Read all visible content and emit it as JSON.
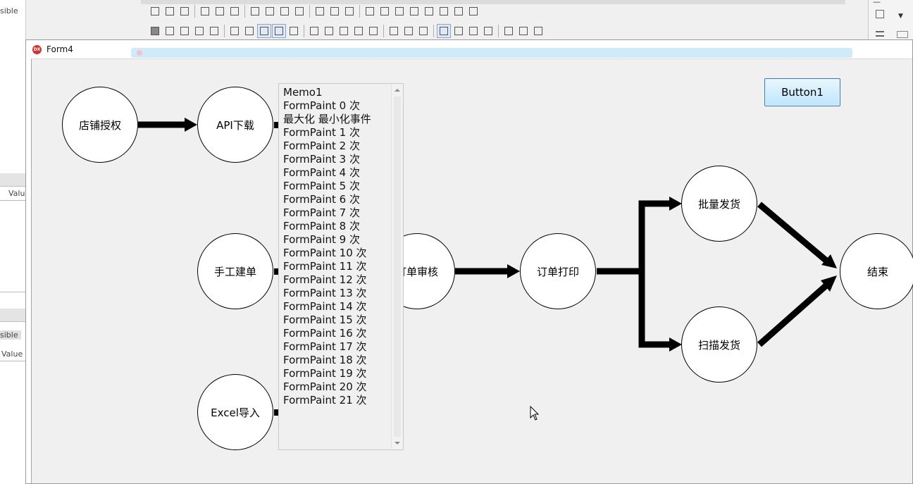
{
  "ide": {
    "left_labels": [
      "sible",
      "Valu",
      "sible",
      "Value"
    ]
  },
  "form": {
    "title": "Form4"
  },
  "nodes": {
    "store_auth": "店铺授权",
    "api_download": "API下载",
    "manual_order": "手工建单",
    "excel_import": "Excel导入",
    "order_review": "订单审核",
    "order_print": "订单打印",
    "batch_ship": "批量发货",
    "scan_ship": "扫描发货",
    "end": "结束"
  },
  "memo": {
    "lines": [
      "Memo1",
      "FormPaint 0 次",
      "最大化 最小化事件",
      "FormPaint 1 次",
      "FormPaint 2 次",
      "FormPaint 3 次",
      "FormPaint 4 次",
      "FormPaint 5 次",
      "FormPaint 6 次",
      "FormPaint 7 次",
      "FormPaint 8 次",
      "FormPaint 9 次",
      "FormPaint 10 次",
      "FormPaint 11 次",
      "FormPaint 12 次",
      "FormPaint 13 次",
      "FormPaint 14 次",
      "FormPaint 15 次",
      "FormPaint 16 次",
      "FormPaint 17 次",
      "FormPaint 18 次",
      "FormPaint 19 次",
      "FormPaint 20 次",
      "FormPaint 21 次"
    ]
  },
  "button1": {
    "label": "Button1"
  }
}
